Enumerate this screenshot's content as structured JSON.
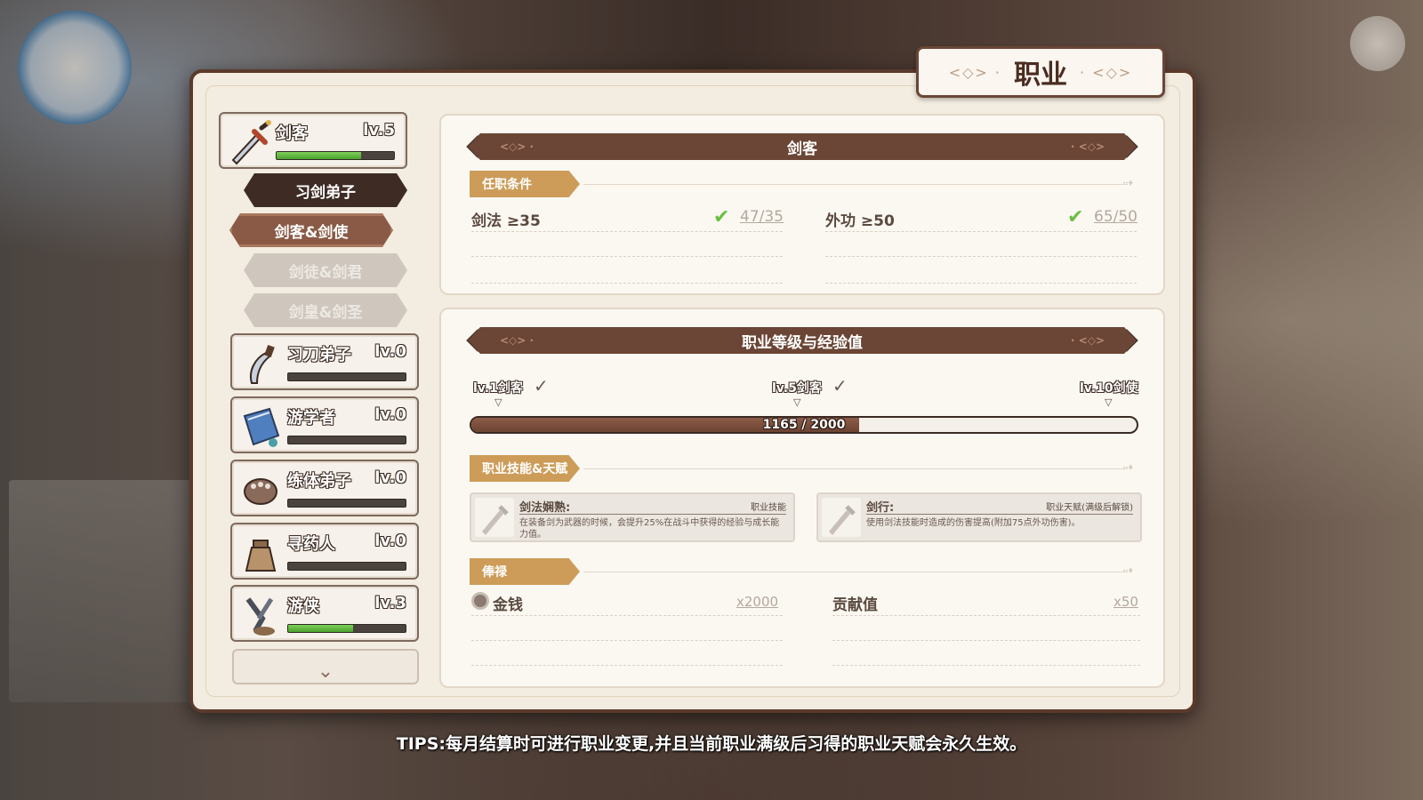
{
  "panel_title": "职业",
  "class_list": [
    {
      "name": "剑客",
      "level": "lv.5",
      "progress": 0.72,
      "icon": "sword-icon",
      "selected": true
    },
    {
      "name": "习刀弟子",
      "level": "lv.0",
      "progress": 0,
      "icon": "saber-icon"
    },
    {
      "name": "游学者",
      "level": "lv.0",
      "progress": 0,
      "icon": "book-icon"
    },
    {
      "name": "练体弟子",
      "level": "lv.0",
      "progress": 0,
      "icon": "gauntlet-icon"
    },
    {
      "name": "寻药人",
      "level": "lv.0",
      "progress": 0,
      "icon": "herb-bag-icon"
    },
    {
      "name": "游侠",
      "level": "lv.3",
      "progress": 0.55,
      "icon": "ranger-icon"
    }
  ],
  "sub_paths": [
    {
      "label": "习剑弟子",
      "state": "completed"
    },
    {
      "label": "剑客&剑使",
      "state": "active"
    },
    {
      "label": "剑徒&剑君",
      "state": "locked"
    },
    {
      "label": "剑皇&剑圣",
      "state": "locked"
    }
  ],
  "requirements": {
    "header": "剑客",
    "tag": "任职条件",
    "items": [
      {
        "label": "剑法 ≥35",
        "value": "47/35",
        "met": true
      },
      {
        "label": "外功 ≥50",
        "value": "65/50",
        "met": true
      }
    ]
  },
  "experience": {
    "header": "职业等级与经验值",
    "milestones": [
      {
        "label": "lv.1剑客",
        "done": true
      },
      {
        "label": "lv.5剑客",
        "done": true
      },
      {
        "label": "lv.10剑使",
        "done": false
      }
    ],
    "current": 1165,
    "max": 2000,
    "text": "1165 / 2000",
    "skills_tag": "职业技能&天赋",
    "skills": [
      {
        "name": "剑法娴熟:",
        "type": "职业技能",
        "desc": "在装备剑为武器的时候，会提升25%在战斗中获得的经验与成长能力值。"
      },
      {
        "name": "剑行:",
        "type": "职业天赋(满级后解锁)",
        "desc": "使用剑法技能时造成的伤害提高(附加75点外功伤害)。"
      }
    ],
    "salary_tag": "俸禄",
    "salary": [
      {
        "label": "金钱",
        "value": "x2000"
      },
      {
        "label": "贡献值",
        "value": "x50"
      }
    ]
  },
  "tips": "TIPS:每月结算时可进行职业变更,并且当前职业满级后习得的职业天赋会永久生效。",
  "colors": {
    "accent": "#6b4535",
    "tag": "#cc9c58",
    "progress": "#4aa22c",
    "check": "#6bbf40"
  }
}
